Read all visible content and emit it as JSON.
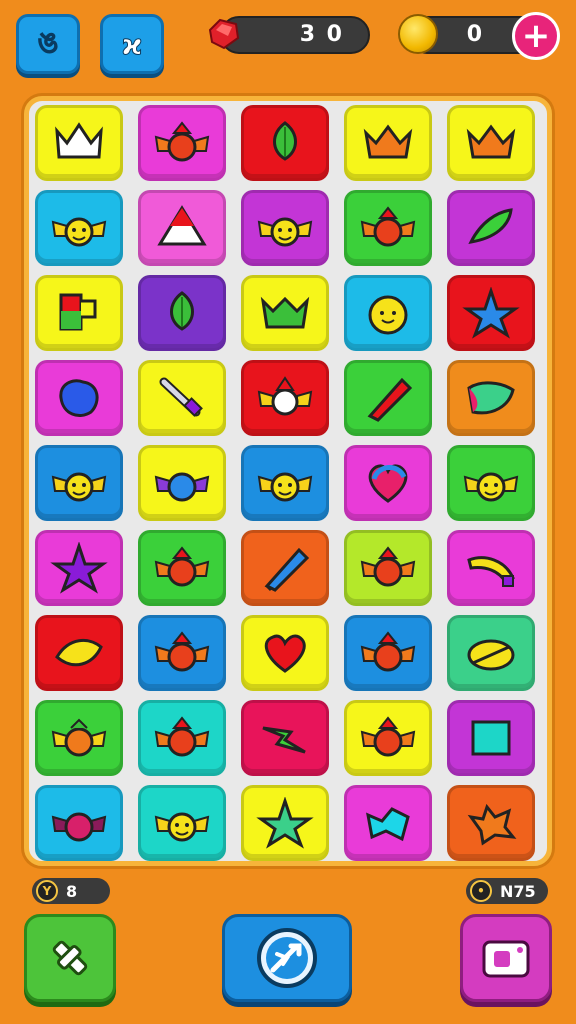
{
  "topbar": {
    "left_button_a_glyph": "ঙ",
    "left_button_b_glyph": "ϰ",
    "gems": "3 0",
    "coins": "0",
    "plus_label": "+"
  },
  "bottom": {
    "moves_value": "8",
    "score_value": "N75"
  },
  "board": {
    "rows": 9,
    "cols": 5,
    "tiles": [
      {
        "bg": "#f6f61a",
        "icon": "crown-white"
      },
      {
        "bg": "#e93bd8",
        "icon": "winged-red"
      },
      {
        "bg": "#e8141c",
        "icon": "bulb-green"
      },
      {
        "bg": "#f6f61a",
        "icon": "crown-orange"
      },
      {
        "bg": "#f6f61a",
        "icon": "crown-orange"
      },
      {
        "bg": "#1dbbe8",
        "icon": "winged-yellow"
      },
      {
        "bg": "#f05ad8",
        "icon": "triangle"
      },
      {
        "bg": "#c335d6",
        "icon": "winged-yellow"
      },
      {
        "bg": "#3bd03a",
        "icon": "winged-red"
      },
      {
        "bg": "#c335d6",
        "icon": "leaf-green"
      },
      {
        "bg": "#f6f61a",
        "icon": "flag"
      },
      {
        "bg": "#7b33c9",
        "icon": "bulb-green"
      },
      {
        "bg": "#f6f61a",
        "icon": "crown-green"
      },
      {
        "bg": "#1dbbe8",
        "icon": "sun-face"
      },
      {
        "bg": "#e8141c",
        "icon": "star-blue"
      },
      {
        "bg": "#e93bd8",
        "icon": "blob-blue"
      },
      {
        "bg": "#f6f61a",
        "icon": "sword"
      },
      {
        "bg": "#e8141c",
        "icon": "winged-white"
      },
      {
        "bg": "#3bd03a",
        "icon": "pencil-red"
      },
      {
        "bg": "#f08c1c",
        "icon": "shield-green"
      },
      {
        "bg": "#1d8fe0",
        "icon": "winged-yellow"
      },
      {
        "bg": "#f6f61a",
        "icon": "winged-blue"
      },
      {
        "bg": "#1d8fe0",
        "icon": "winged-yellow"
      },
      {
        "bg": "#e93bd8",
        "icon": "heart-rainbow"
      },
      {
        "bg": "#3bd03a",
        "icon": "winged-yellow"
      },
      {
        "bg": "#e93bd8",
        "icon": "star-purple"
      },
      {
        "bg": "#3bd03a",
        "icon": "winged-red"
      },
      {
        "bg": "#f0621c",
        "icon": "pencil-blue"
      },
      {
        "bg": "#b4e82a",
        "icon": "winged-red"
      },
      {
        "bg": "#e93bd8",
        "icon": "banana"
      },
      {
        "bg": "#e8141c",
        "icon": "bird-yellow"
      },
      {
        "bg": "#1d8fe0",
        "icon": "winged-red"
      },
      {
        "bg": "#f6f61a",
        "icon": "heart-red"
      },
      {
        "bg": "#1d8fe0",
        "icon": "winged-red"
      },
      {
        "bg": "#3bd08a",
        "icon": "lemon"
      },
      {
        "bg": "#3bd03a",
        "icon": "winged-orange"
      },
      {
        "bg": "#1dd6c8",
        "icon": "winged-red"
      },
      {
        "bg": "#e8145a",
        "icon": "zigzag-green"
      },
      {
        "bg": "#f6f61a",
        "icon": "winged-red"
      },
      {
        "bg": "#c335d6",
        "icon": "square-teal"
      },
      {
        "bg": "#1dbbe8",
        "icon": "winged-pink"
      },
      {
        "bg": "#1dd6c8",
        "icon": "winged-yellow"
      },
      {
        "bg": "#f6f61a",
        "icon": "star-green"
      },
      {
        "bg": "#e93bd8",
        "icon": "blob-cyan"
      },
      {
        "bg": "#f0621c",
        "icon": "splat-orange"
      }
    ]
  }
}
